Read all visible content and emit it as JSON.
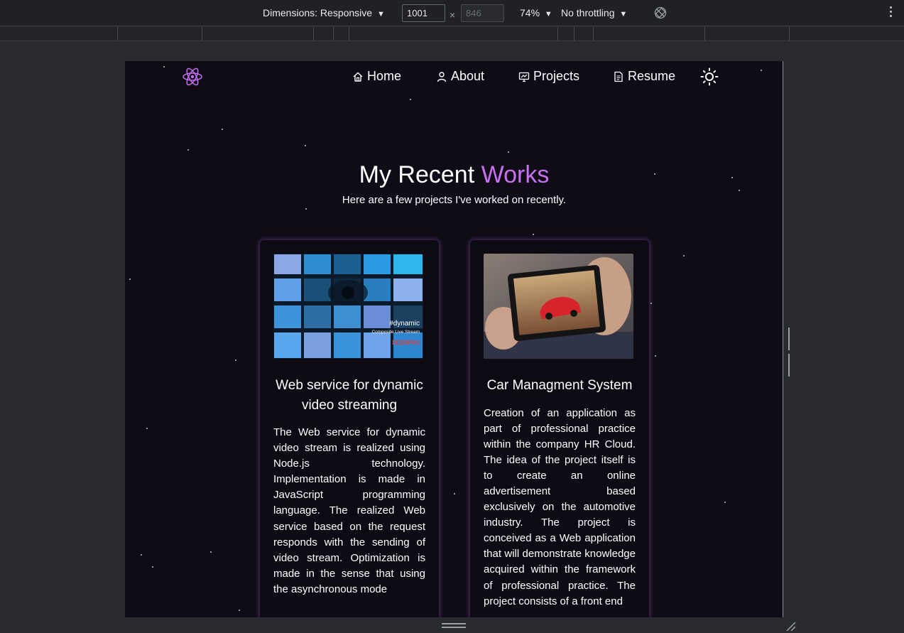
{
  "devtools": {
    "dimensions_label": "Dimensions: Responsive",
    "width_value": "1001",
    "height_value": "846",
    "times_symbol": "×",
    "zoom_label": "74%",
    "throttling_label": "No throttling",
    "dropdown_glyph": "▼"
  },
  "site": {
    "nav": {
      "links": [
        {
          "label": "Home",
          "icon": "home-icon"
        },
        {
          "label": "About",
          "icon": "user-icon"
        },
        {
          "label": "Projects",
          "icon": "projects-icon"
        },
        {
          "label": "Resume",
          "icon": "document-icon"
        }
      ],
      "logo_icon": "atom-logo-icon",
      "theme_icon": "sun-icon"
    },
    "heading": {
      "prefix": "My Recent ",
      "accent": "Works",
      "accent_color": "#c770f0"
    },
    "subheading": "Here are a few projects I've worked on recently.",
    "projects": [
      {
        "title": "Web service for dynamic video streaming",
        "image_caption": "#dynamic",
        "image_subcaption": "Composite Live Stream",
        "image_brand": "RED5PRO",
        "description": "The Web service for dynamic video stream is realized using Node.js technology. Implementation is made in JavaScript programming language. The realized Web service based on the request responds with the sending of video stream. Optimization is made in the sense that using the asynchronous mode"
      },
      {
        "title": "Car Managment System",
        "description": "Creation of an application as part of professional practice within the company HR Cloud. The idea of the project itself is to create an online advertisement based exclusively on the automotive industry. The project is conceived as a Web application that will demonstrate knowledge acquired within the framework of professional practice. The project consists of a front end"
      }
    ]
  },
  "colors": {
    "background": "#0f0c17",
    "card_glow": "#8148a0",
    "devtools_bar": "#202124"
  }
}
